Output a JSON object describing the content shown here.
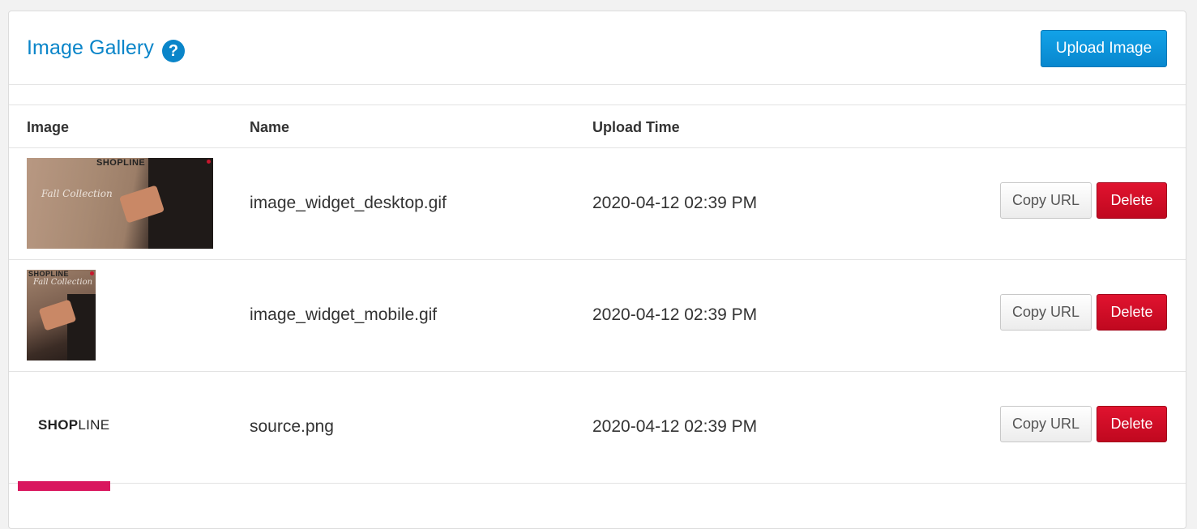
{
  "header": {
    "title": "Image Gallery",
    "help_icon": "question-circle-icon",
    "upload_label": "Upload Image"
  },
  "table": {
    "columns": [
      "Image",
      "Name",
      "Upload Time"
    ],
    "rows": [
      {
        "thumbnail": "desktop-banner-thumbnail",
        "thumb_brand": "SHOPLINE",
        "thumb_caption": "Fall Collection",
        "name": "image_widget_desktop.gif",
        "upload_time": "2020-04-12 02:39 PM",
        "copy_label": "Copy URL",
        "delete_label": "Delete"
      },
      {
        "thumbnail": "mobile-banner-thumbnail",
        "thumb_brand": "SHOPLINE",
        "thumb_caption": "Fall Collection",
        "name": "image_widget_mobile.gif",
        "upload_time": "2020-04-12 02:39 PM",
        "copy_label": "Copy URL",
        "delete_label": "Delete"
      },
      {
        "thumbnail": "logo-thumbnail",
        "thumb_logo_bold": "SHOP",
        "thumb_logo_light": "LINE",
        "name": "source.png",
        "upload_time": "2020-04-12 02:39 PM",
        "copy_label": "Copy URL",
        "delete_label": "Delete"
      }
    ]
  },
  "colors": {
    "accent": "#0a85c9",
    "danger": "#c8102e",
    "pink_bar": "#d9175e"
  }
}
